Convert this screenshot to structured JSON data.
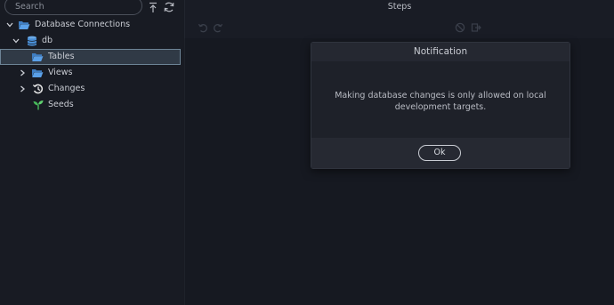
{
  "search": {
    "placeholder": "Search"
  },
  "toolbar": {
    "collapse_icon": "collapse-all-icon",
    "refresh_icon": "refresh-icon"
  },
  "tree": {
    "root": {
      "label": "Database Connections",
      "icon": "folder-open-icon"
    },
    "db": {
      "label": "db",
      "icon": "database-icon"
    },
    "items": [
      {
        "label": "Tables",
        "icon": "folder-open-icon",
        "selected": true
      },
      {
        "label": "Views",
        "icon": "folder-open-icon"
      },
      {
        "label": "Changes",
        "icon": "history-icon"
      },
      {
        "label": "Seeds",
        "icon": "seedling-icon"
      }
    ]
  },
  "main": {
    "title": "Steps",
    "icons": [
      "undo-icon",
      "redo-icon",
      "block-icon",
      "export-icon"
    ]
  },
  "dialog": {
    "title": "Notification",
    "message": "Making database changes is only allowed on local development targets.",
    "ok_label": "Ok"
  },
  "colors": {
    "background": "#181b23",
    "folder": "#4a8fd6",
    "history": "#e6e6e6",
    "seedling": "#46b95a"
  }
}
